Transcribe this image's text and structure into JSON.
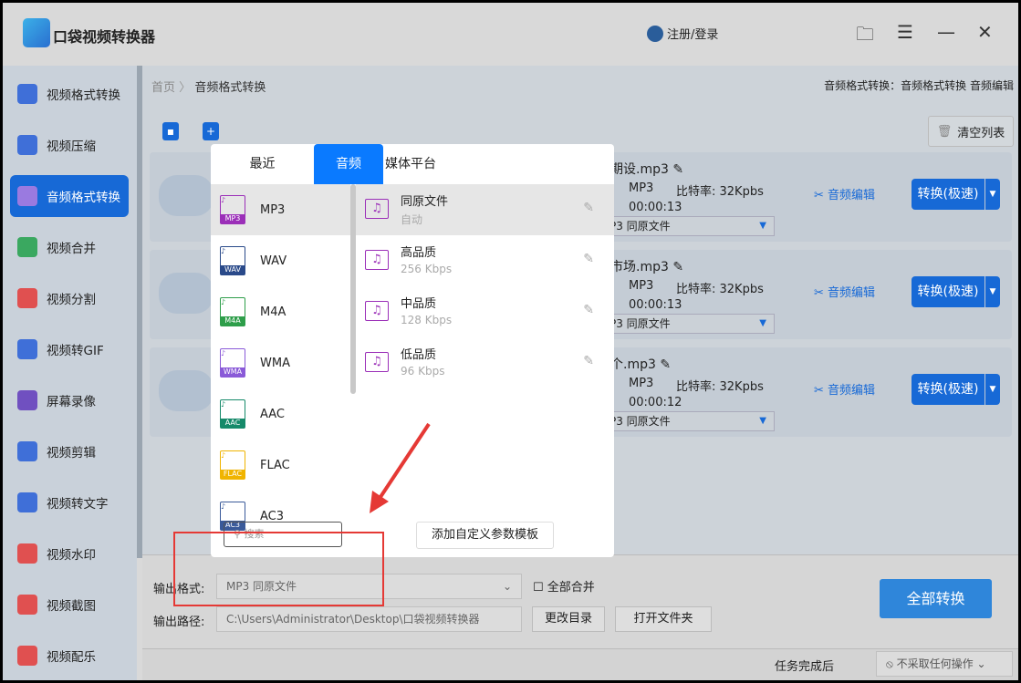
{
  "app": {
    "title": "口袋视频转换器",
    "login": "注册/登录"
  },
  "sidebar": {
    "items": [
      {
        "label": "视频格式转换"
      },
      {
        "label": "视频压缩"
      },
      {
        "label": "音频格式转换"
      },
      {
        "label": "视频合并"
      },
      {
        "label": "视频分割"
      },
      {
        "label": "视频转GIF"
      },
      {
        "label": "屏幕录像"
      },
      {
        "label": "视频剪辑"
      },
      {
        "label": "视频转文字"
      },
      {
        "label": "视频水印"
      },
      {
        "label": "视频截图"
      },
      {
        "label": "视频配乐"
      }
    ],
    "active": "音频格式转换"
  },
  "breadcrumb": {
    "home": "首页",
    "sep": "〉",
    "current": "音频格式转换"
  },
  "header_right": "音频格式转换：音频格式转换 音频编辑",
  "toolbar": {
    "clear": "清空列表"
  },
  "files": [
    {
      "name": "期设.mp3",
      "format": "MP3",
      "bitrate": "比特率:  32Kpbs",
      "duration": "00:00:13",
      "output": "P3  同原文件",
      "edit": "音频编辑",
      "convert": "转换(极速)"
    },
    {
      "name": "市场.mp3",
      "format": "MP3",
      "bitrate": "比特率:  32Kpbs",
      "duration": "00:00:13",
      "output": "P3  同原文件",
      "edit": "音频编辑",
      "convert": "转换(极速)"
    },
    {
      "name": "个.mp3",
      "format": "MP3",
      "bitrate": "比特率:  32Kpbs",
      "duration": "00:00:12",
      "output": "P3  同原文件",
      "edit": "音频编辑",
      "convert": "转换(极速)"
    }
  ],
  "popup": {
    "tabs": [
      "最近",
      "音频",
      "媒体平台"
    ],
    "active_tab": "音频",
    "formats": [
      {
        "label": "MP3",
        "color": "#9b2fb8"
      },
      {
        "label": "WAV",
        "color": "#2a4a8a"
      },
      {
        "label": "M4A",
        "color": "#2e9e4a"
      },
      {
        "label": "WMA",
        "color": "#8a5ad8"
      },
      {
        "label": "AAC",
        "color": "#168a6a"
      },
      {
        "label": "FLAC",
        "color": "#f0b400"
      },
      {
        "label": "AC3",
        "color": "#3a5a9a"
      }
    ],
    "qualities": [
      {
        "title": "同原文件",
        "sub": "自动"
      },
      {
        "title": "高品质",
        "sub": "256 Kbps"
      },
      {
        "title": "中品质",
        "sub": "128 Kbps"
      },
      {
        "title": "低品质",
        "sub": "96 Kbps"
      }
    ],
    "search_placeholder": "搜索",
    "add_template": "添加自定义参数模板"
  },
  "bottom": {
    "format_label": "输出格式:",
    "format_value": "MP3  同原文件",
    "merge": "全部合并",
    "path_label": "输出路径:",
    "path_value": "C:\\Users\\Administrator\\Desktop\\口袋视频转换器",
    "change_dir": "更改目录",
    "open_folder": "打开文件夹",
    "convert_all": "全部转换",
    "after_label": "任务完成后",
    "after_value": "不采取任何操作"
  }
}
